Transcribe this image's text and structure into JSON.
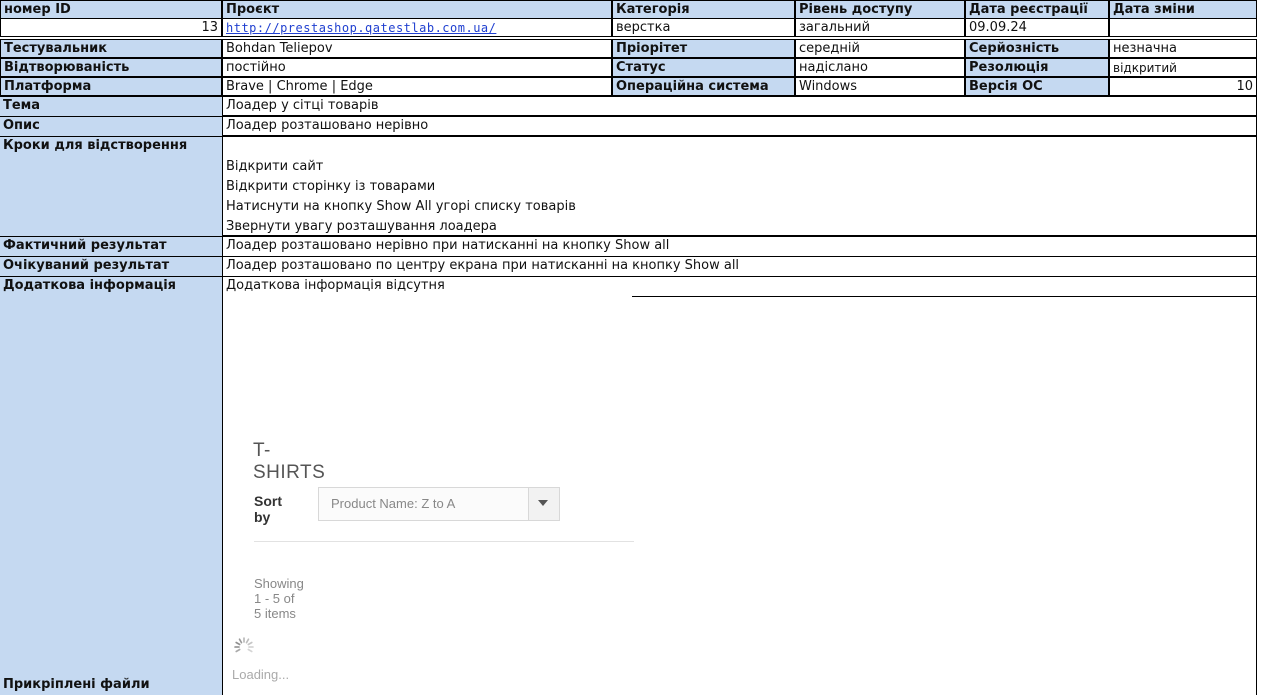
{
  "header": {
    "id": "номер ID",
    "project": "Проєкт",
    "category": "Категорія",
    "access": "Рівень доступу",
    "reg_date": "Дата реєстрації",
    "mod_date": "Дата зміни"
  },
  "record": {
    "id": "13",
    "project_url": "http://prestashop.qatestlab.com.ua/",
    "category": "верстка",
    "access": "загальний",
    "reg_date": "09.09.24",
    "mod_date": ""
  },
  "fields": {
    "tester_label": "Тестувальник",
    "tester": "Bohdan Teliepov",
    "priority_label": "Пріорітет",
    "priority": "середній",
    "severity_label": "Серйозність",
    "severity": "незначна",
    "repro_label": "Відтворюваність",
    "repro": "постійно",
    "status_label": "Статус",
    "status": "надіслано",
    "resolution_label": "Резолюція",
    "resolution": "відкритий",
    "platform_label": "Платформа",
    "platform": "Brave | Chrome | Edge",
    "os_label": "Операційна система",
    "os": "Windows",
    "os_version_label": "Версія ОС",
    "os_version": "10"
  },
  "rows": {
    "topic_label": "Тема",
    "topic": "Лоадер у сітці товарів",
    "desc_label": "Опис",
    "desc": "Лоадер розташовано нерівно",
    "steps_label": "Кроки для відстворення",
    "steps": [
      "Відкрити сайт",
      "Відкрити сторінку із товарами",
      "Натиснути на кнопку Show All угорі списку товарів",
      "Звернути увагу  розташування лоадера"
    ],
    "actual_label": "Фактичний результат",
    "actual": "Лоадер розташовано нерівно при натисканні на кнопку Show all",
    "expected_label": "Очікуваний результат",
    "expected": "Лоадер розташовано по центру екрана при натисканні на кнопку Show all",
    "extra_label": "Додаткова інформація",
    "extra": "Додаткова інформація відсутня",
    "attachments_label": "Прикріплені файли"
  },
  "screenshot": {
    "title": "T-SHIRTS",
    "sort_label": "Sort by",
    "sort_value": "Product Name: Z to A",
    "showing": "Showing 1 - 5 of 5 items",
    "loading": "Loading..."
  }
}
